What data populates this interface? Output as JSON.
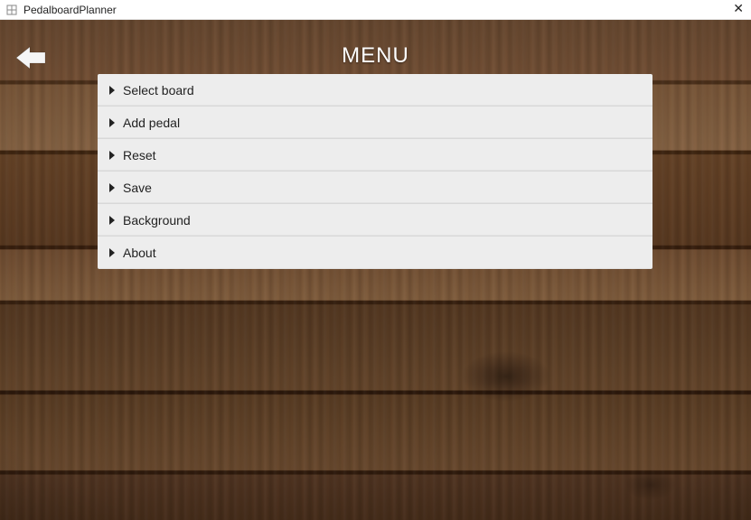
{
  "window": {
    "title": "PedalboardPlanner"
  },
  "header": {
    "title": "MENU"
  },
  "menu": {
    "items": [
      {
        "label": "Select board"
      },
      {
        "label": "Add pedal"
      },
      {
        "label": "Reset"
      },
      {
        "label": "Save"
      },
      {
        "label": "Background"
      },
      {
        "label": "About"
      }
    ]
  }
}
